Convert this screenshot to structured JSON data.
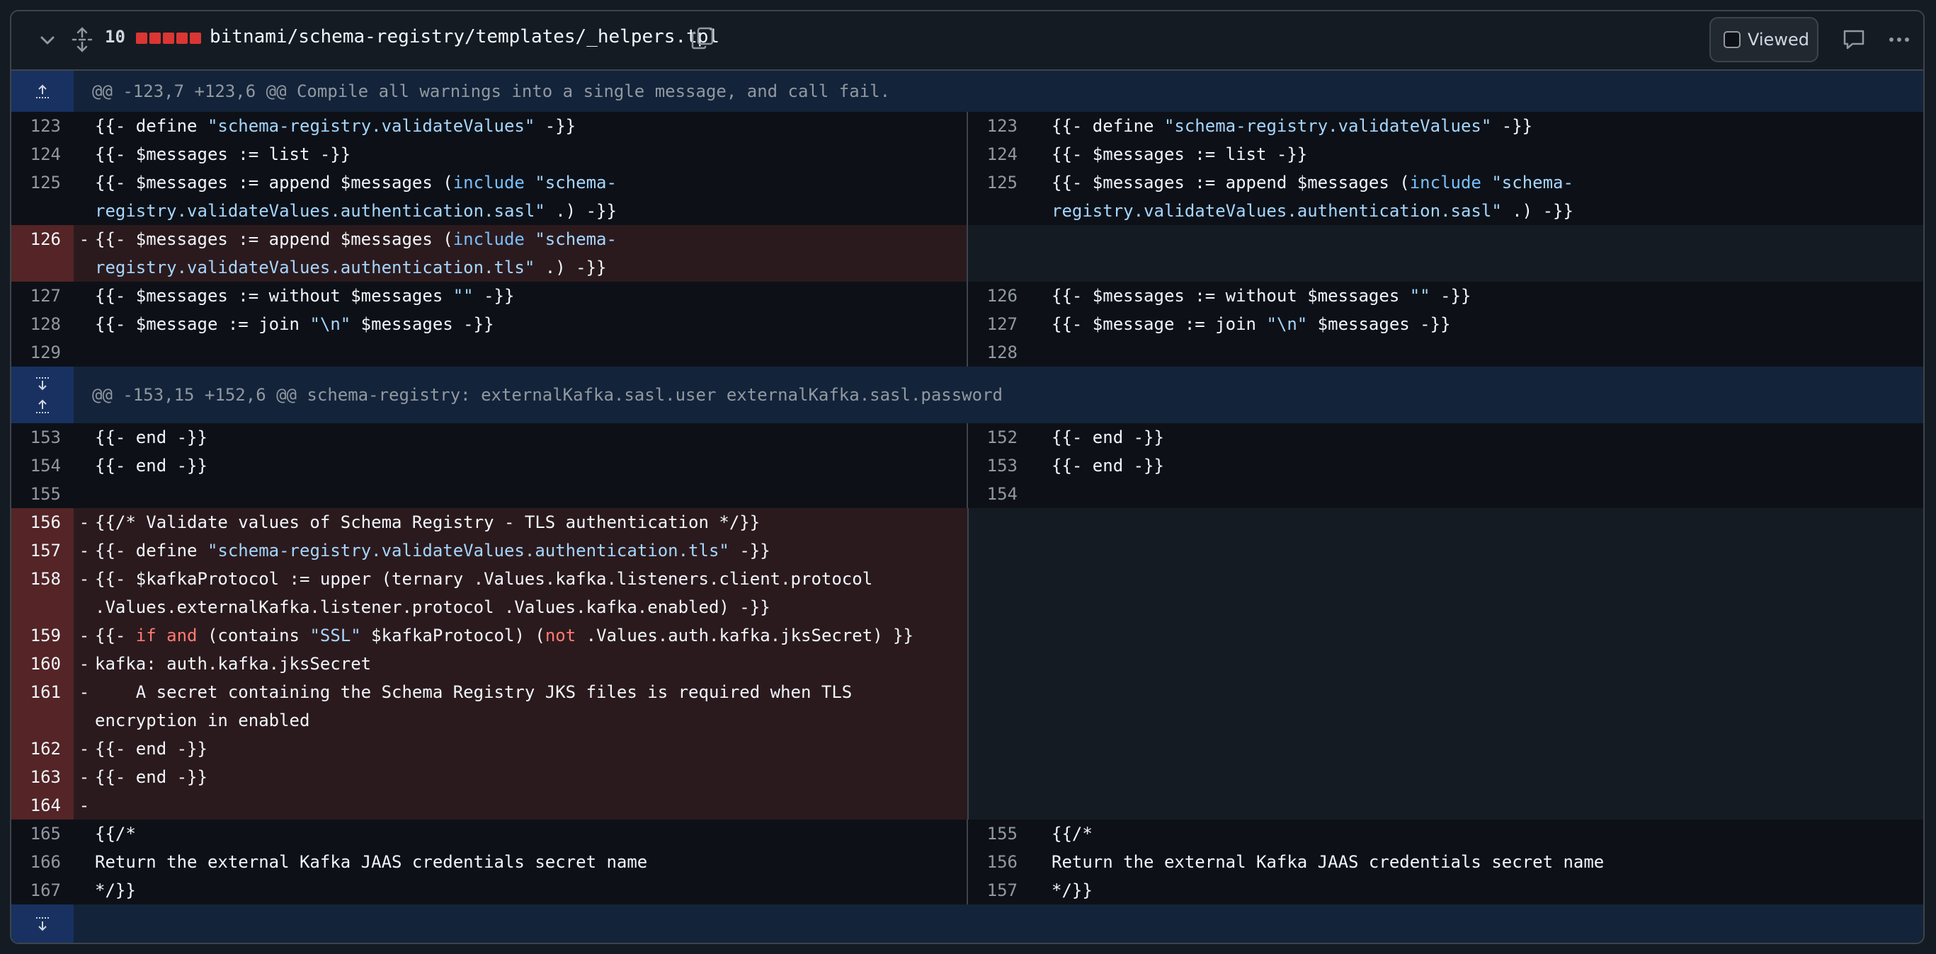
{
  "header": {
    "changes": "10",
    "path": "bitnami/schema-registry/templates/_helpers.tpl",
    "viewed_label": "Viewed"
  },
  "hunks": [
    "@@ -123,7 +123,6 @@ Compile all warnings into a single message, and call fail.",
    "@@ -153,15 +152,6 @@ schema-registry: externalKafka.sasl.user externalKafka.sasl.password"
  ],
  "lines": {
    "l123": "{{- define ",
    "l123s": "\"schema-registry.validateValues\"",
    "l123e": " -}}",
    "l124": "{{- $messages := list -}}",
    "l125a": "{{- $messages := append $messages (",
    "l125inc": "include",
    "l125s": " \"schema-registry.validateValues.authentication.sasl\"",
    "l125e": " .) -}}",
    "l126a": "{{- $messages := append $messages (",
    "l126inc": "include",
    "l126s": " \"schema-registry.validateValues.authentication.tls\"",
    "l126e": " .) -}}",
    "l127a": "{{- $messages := without $messages ",
    "l127s": "\"\"",
    "l127e": " -}}",
    "l128a": "{{- $message := join ",
    "l128s": "\"\\n\"",
    "l128e": " $messages -}}",
    "l153": "{{- end -}}",
    "l154": "{{- end -}}",
    "l156": "{{/* Validate values of Schema Registry - TLS authentication */}}",
    "l157a": "{{- define ",
    "l157s": "\"schema-registry.validateValues.authentication.tls\"",
    "l157e": " -}}",
    "l158": "{{- $kafkaProtocol := upper (ternary .Values.kafka.listeners.client.protocol .Values.externalKafka.listener.protocol .Values.kafka.enabled) -}}",
    "l159a": "{{- ",
    "l159if": "if",
    "l159and": "and",
    "l159b": " (contains ",
    "l159s": "\"SSL\"",
    "l159c": " $kafkaProtocol) (",
    "l159not": "not",
    "l159d": " .Values.auth.kafka.jksSecret) }}",
    "l160": "kafka: auth.kafka.jksSecret",
    "l161": "    A secret containing the Schema Registry JKS files is required when TLS encryption in enabled",
    "l162": "{{- end -}}",
    "l163": "{{- end -}}",
    "l165": "{{/*",
    "l166": "Return the external Kafka JAAS credentials secret name",
    "l167": "*/}}"
  },
  "nums": {
    "left": [
      "123",
      "124",
      "125",
      "126",
      "127",
      "128",
      "129",
      "153",
      "154",
      "155",
      "156",
      "157",
      "158",
      "159",
      "160",
      "161",
      "162",
      "163",
      "164",
      "165",
      "166",
      "167"
    ],
    "right": [
      "123",
      "124",
      "125",
      "126",
      "127",
      "128",
      "152",
      "153",
      "154",
      "155",
      "156",
      "157"
    ]
  },
  "markers": {
    "minus": "-"
  }
}
